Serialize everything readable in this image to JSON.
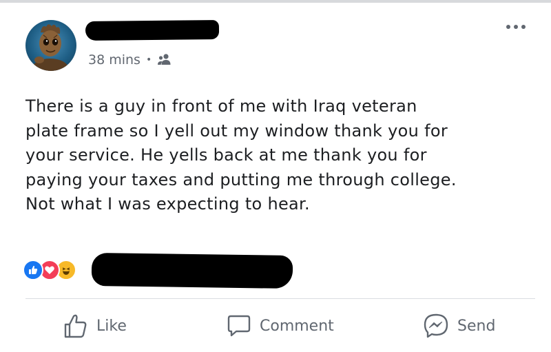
{
  "post": {
    "author_name": "",
    "timestamp": "38 mins",
    "separator": "•",
    "audience_icon": "friends-icon",
    "text": "There is a guy in front of me with Iraq veteran\nplate frame so I yell out my window thank you for\nyour service. He yells back at me thank you for\npaying your taxes and putting me through college.\nNot what I was expecting to hear.",
    "more_icon": "more-options-icon"
  },
  "reactions": {
    "icons": [
      "like-reaction-icon",
      "love-reaction-icon",
      "haha-reaction-icon"
    ],
    "colors": {
      "like": "#1877f2",
      "love": "#f33e58",
      "haha": "#f7b928"
    }
  },
  "actions": {
    "like_label": "Like",
    "comment_label": "Comment",
    "send_label": "Send"
  },
  "colors": {
    "text": "#1c1e21",
    "secondary_text": "#616770",
    "divider": "#dadde1"
  }
}
